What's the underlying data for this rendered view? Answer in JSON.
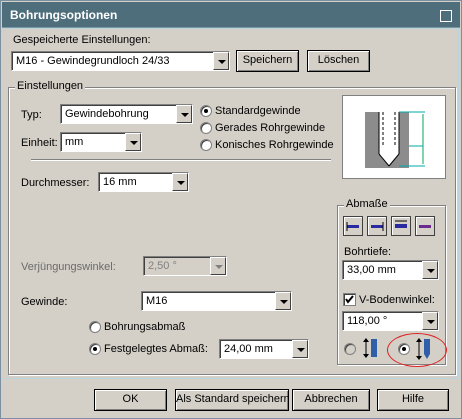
{
  "window": {
    "title": "Bohrungsoptionen"
  },
  "saved": {
    "label": "Gespeicherte Einstellungen:",
    "value": "M16 - Gewindegrundloch 24/33",
    "save_button": "Speichern",
    "delete_button": "Löschen"
  },
  "settings": {
    "group_label": "Einstellungen",
    "type_label": "Typ:",
    "type_value": "Gewindebohrung",
    "unit_label": "Einheit:",
    "unit_value": "mm",
    "thread_options": [
      {
        "label": "Standardgewinde",
        "checked": true
      },
      {
        "label": "Gerades Rohrgewinde",
        "checked": false
      },
      {
        "label": "Konisches Rohrgewinde",
        "checked": false
      }
    ],
    "diameter_label": "Durchmesser:",
    "diameter_value": "16 mm",
    "taper_label": "Verjüngungswinkel:",
    "taper_value": "2,50 °",
    "thread_label": "Gewinde:",
    "thread_value": "M16",
    "offset_options": {
      "bore": "Bohrungsabmaß",
      "fixed": "Festgelegtes Abmaß:"
    },
    "fixed_offset_value": "24,00 mm"
  },
  "dimensions": {
    "group_label": "Abmaße",
    "depth_label": "Bohrtiefe:",
    "depth_value": "33,00 mm",
    "vbottom_label": "V-Bodenwinkel:",
    "vbottom_checked": true,
    "vbottom_value": "118,00 °"
  },
  "buttons": {
    "ok": "OK",
    "save_default": "Als Standard speichern",
    "cancel": "Abbrechen",
    "help": "Hilfe"
  }
}
